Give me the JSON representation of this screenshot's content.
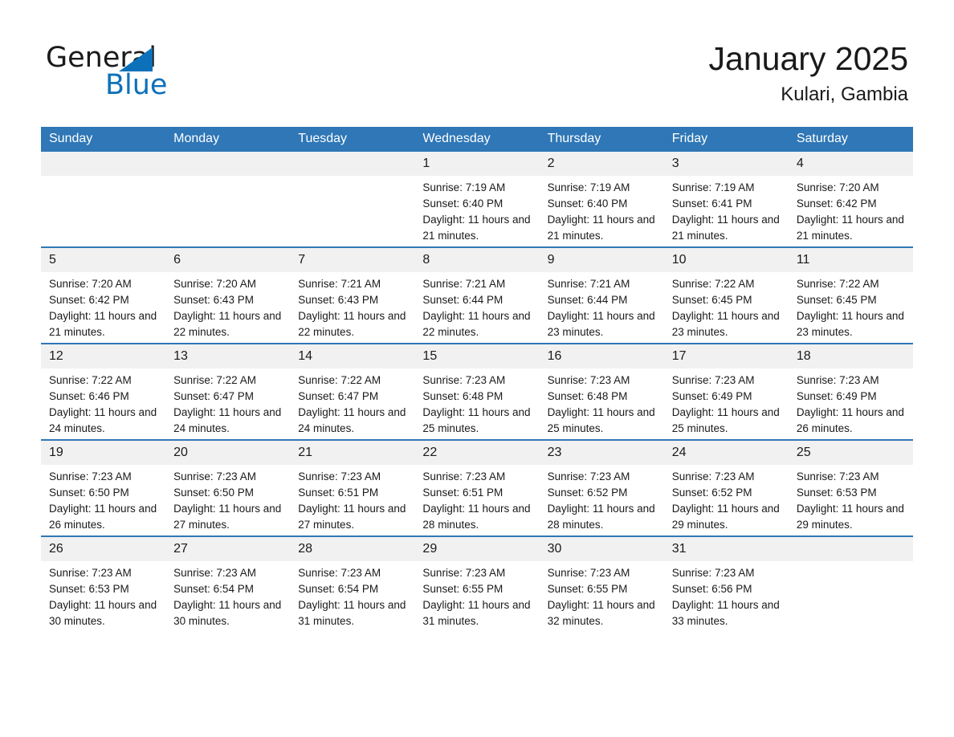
{
  "brand": {
    "name_part1": "General",
    "name_part2": "Blue",
    "accent_color": "#0d71ba",
    "triangle_icon": "triangle-icon"
  },
  "header": {
    "title": "January 2025",
    "location": "Kulari, Gambia"
  },
  "calendar": {
    "header_bg": "#2f77b6",
    "daynum_bg": "#f1f1f1",
    "weekday_headers": [
      "Sunday",
      "Monday",
      "Tuesday",
      "Wednesday",
      "Thursday",
      "Friday",
      "Saturday"
    ],
    "weeks": [
      [
        {
          "day": "",
          "sunrise": "",
          "sunset": "",
          "daylight": ""
        },
        {
          "day": "",
          "sunrise": "",
          "sunset": "",
          "daylight": ""
        },
        {
          "day": "",
          "sunrise": "",
          "sunset": "",
          "daylight": ""
        },
        {
          "day": "1",
          "sunrise": "Sunrise: 7:19 AM",
          "sunset": "Sunset: 6:40 PM",
          "daylight": "Daylight: 11 hours and 21 minutes."
        },
        {
          "day": "2",
          "sunrise": "Sunrise: 7:19 AM",
          "sunset": "Sunset: 6:40 PM",
          "daylight": "Daylight: 11 hours and 21 minutes."
        },
        {
          "day": "3",
          "sunrise": "Sunrise: 7:19 AM",
          "sunset": "Sunset: 6:41 PM",
          "daylight": "Daylight: 11 hours and 21 minutes."
        },
        {
          "day": "4",
          "sunrise": "Sunrise: 7:20 AM",
          "sunset": "Sunset: 6:42 PM",
          "daylight": "Daylight: 11 hours and 21 minutes."
        }
      ],
      [
        {
          "day": "5",
          "sunrise": "Sunrise: 7:20 AM",
          "sunset": "Sunset: 6:42 PM",
          "daylight": "Daylight: 11 hours and 21 minutes."
        },
        {
          "day": "6",
          "sunrise": "Sunrise: 7:20 AM",
          "sunset": "Sunset: 6:43 PM",
          "daylight": "Daylight: 11 hours and 22 minutes."
        },
        {
          "day": "7",
          "sunrise": "Sunrise: 7:21 AM",
          "sunset": "Sunset: 6:43 PM",
          "daylight": "Daylight: 11 hours and 22 minutes."
        },
        {
          "day": "8",
          "sunrise": "Sunrise: 7:21 AM",
          "sunset": "Sunset: 6:44 PM",
          "daylight": "Daylight: 11 hours and 22 minutes."
        },
        {
          "day": "9",
          "sunrise": "Sunrise: 7:21 AM",
          "sunset": "Sunset: 6:44 PM",
          "daylight": "Daylight: 11 hours and 23 minutes."
        },
        {
          "day": "10",
          "sunrise": "Sunrise: 7:22 AM",
          "sunset": "Sunset: 6:45 PM",
          "daylight": "Daylight: 11 hours and 23 minutes."
        },
        {
          "day": "11",
          "sunrise": "Sunrise: 7:22 AM",
          "sunset": "Sunset: 6:45 PM",
          "daylight": "Daylight: 11 hours and 23 minutes."
        }
      ],
      [
        {
          "day": "12",
          "sunrise": "Sunrise: 7:22 AM",
          "sunset": "Sunset: 6:46 PM",
          "daylight": "Daylight: 11 hours and 24 minutes."
        },
        {
          "day": "13",
          "sunrise": "Sunrise: 7:22 AM",
          "sunset": "Sunset: 6:47 PM",
          "daylight": "Daylight: 11 hours and 24 minutes."
        },
        {
          "day": "14",
          "sunrise": "Sunrise: 7:22 AM",
          "sunset": "Sunset: 6:47 PM",
          "daylight": "Daylight: 11 hours and 24 minutes."
        },
        {
          "day": "15",
          "sunrise": "Sunrise: 7:23 AM",
          "sunset": "Sunset: 6:48 PM",
          "daylight": "Daylight: 11 hours and 25 minutes."
        },
        {
          "day": "16",
          "sunrise": "Sunrise: 7:23 AM",
          "sunset": "Sunset: 6:48 PM",
          "daylight": "Daylight: 11 hours and 25 minutes."
        },
        {
          "day": "17",
          "sunrise": "Sunrise: 7:23 AM",
          "sunset": "Sunset: 6:49 PM",
          "daylight": "Daylight: 11 hours and 25 minutes."
        },
        {
          "day": "18",
          "sunrise": "Sunrise: 7:23 AM",
          "sunset": "Sunset: 6:49 PM",
          "daylight": "Daylight: 11 hours and 26 minutes."
        }
      ],
      [
        {
          "day": "19",
          "sunrise": "Sunrise: 7:23 AM",
          "sunset": "Sunset: 6:50 PM",
          "daylight": "Daylight: 11 hours and 26 minutes."
        },
        {
          "day": "20",
          "sunrise": "Sunrise: 7:23 AM",
          "sunset": "Sunset: 6:50 PM",
          "daylight": "Daylight: 11 hours and 27 minutes."
        },
        {
          "day": "21",
          "sunrise": "Sunrise: 7:23 AM",
          "sunset": "Sunset: 6:51 PM",
          "daylight": "Daylight: 11 hours and 27 minutes."
        },
        {
          "day": "22",
          "sunrise": "Sunrise: 7:23 AM",
          "sunset": "Sunset: 6:51 PM",
          "daylight": "Daylight: 11 hours and 28 minutes."
        },
        {
          "day": "23",
          "sunrise": "Sunrise: 7:23 AM",
          "sunset": "Sunset: 6:52 PM",
          "daylight": "Daylight: 11 hours and 28 minutes."
        },
        {
          "day": "24",
          "sunrise": "Sunrise: 7:23 AM",
          "sunset": "Sunset: 6:52 PM",
          "daylight": "Daylight: 11 hours and 29 minutes."
        },
        {
          "day": "25",
          "sunrise": "Sunrise: 7:23 AM",
          "sunset": "Sunset: 6:53 PM",
          "daylight": "Daylight: 11 hours and 29 minutes."
        }
      ],
      [
        {
          "day": "26",
          "sunrise": "Sunrise: 7:23 AM",
          "sunset": "Sunset: 6:53 PM",
          "daylight": "Daylight: 11 hours and 30 minutes."
        },
        {
          "day": "27",
          "sunrise": "Sunrise: 7:23 AM",
          "sunset": "Sunset: 6:54 PM",
          "daylight": "Daylight: 11 hours and 30 minutes."
        },
        {
          "day": "28",
          "sunrise": "Sunrise: 7:23 AM",
          "sunset": "Sunset: 6:54 PM",
          "daylight": "Daylight: 11 hours and 31 minutes."
        },
        {
          "day": "29",
          "sunrise": "Sunrise: 7:23 AM",
          "sunset": "Sunset: 6:55 PM",
          "daylight": "Daylight: 11 hours and 31 minutes."
        },
        {
          "day": "30",
          "sunrise": "Sunrise: 7:23 AM",
          "sunset": "Sunset: 6:55 PM",
          "daylight": "Daylight: 11 hours and 32 minutes."
        },
        {
          "day": "31",
          "sunrise": "Sunrise: 7:23 AM",
          "sunset": "Sunset: 6:56 PM",
          "daylight": "Daylight: 11 hours and 33 minutes."
        },
        {
          "day": "",
          "sunrise": "",
          "sunset": "",
          "daylight": ""
        }
      ]
    ]
  }
}
